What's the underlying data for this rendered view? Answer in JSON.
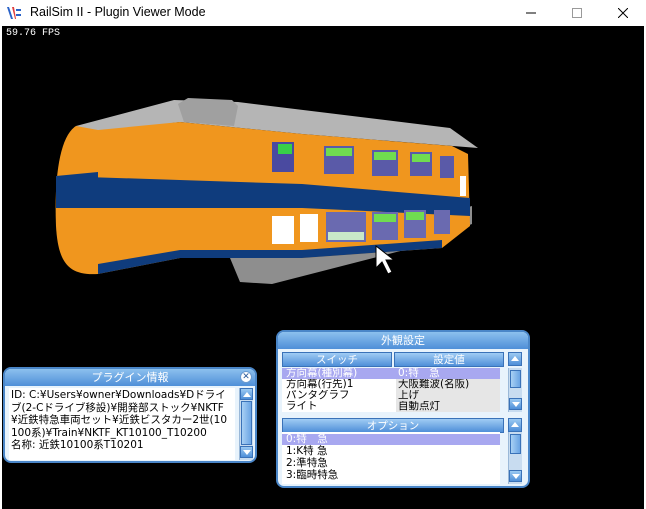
{
  "window": {
    "title": "RailSim II - Plugin Viewer Mode",
    "app_icon": "railsim-app-icon",
    "minimize_icon": "minimize-icon",
    "maximize_icon": "maximize-icon",
    "close_icon": "close-icon"
  },
  "viewport": {
    "fps": "59.76 FPS",
    "background": "#000000",
    "train_colors": {
      "orange": "#f0961e",
      "navy": "#0f3c7d",
      "roof": "#b4b4b4",
      "underbody": "#9a9a9a"
    }
  },
  "plugin_info": {
    "title": "プラグイン情報",
    "close_icon": "close-icon",
    "lines": [
      "ID: C:¥Users¥owner¥Downloads¥Dドライブ(2-Cドライブ移設)¥開発部ストック¥NKTF¥近鉄特急車両セット¥近鉄ビスタカー2世(10100系)¥Train¥NKTF_KT10100_T10200",
      "名称: 近鉄10100系T10201"
    ]
  },
  "appearance": {
    "title": "外観設定",
    "switch_header": "スイッチ",
    "value_header": "設定値",
    "rows": [
      {
        "switch": "方向幕(種別幕)",
        "value": "0:特　急",
        "selected": true
      },
      {
        "switch": "方向幕(行先)1",
        "value": "大阪難波(名阪)",
        "selected": false
      },
      {
        "switch": "パンタグラフ",
        "value": "上げ",
        "selected": false
      },
      {
        "switch": "ライト",
        "value": "自動点灯",
        "selected": false
      }
    ],
    "option_header": "オプション",
    "options": [
      {
        "label": "0:特　急",
        "selected": true
      },
      {
        "label": "1:K特 急",
        "selected": false
      },
      {
        "label": "2:準特急",
        "selected": false
      },
      {
        "label": "3:臨時特急",
        "selected": false
      }
    ]
  }
}
